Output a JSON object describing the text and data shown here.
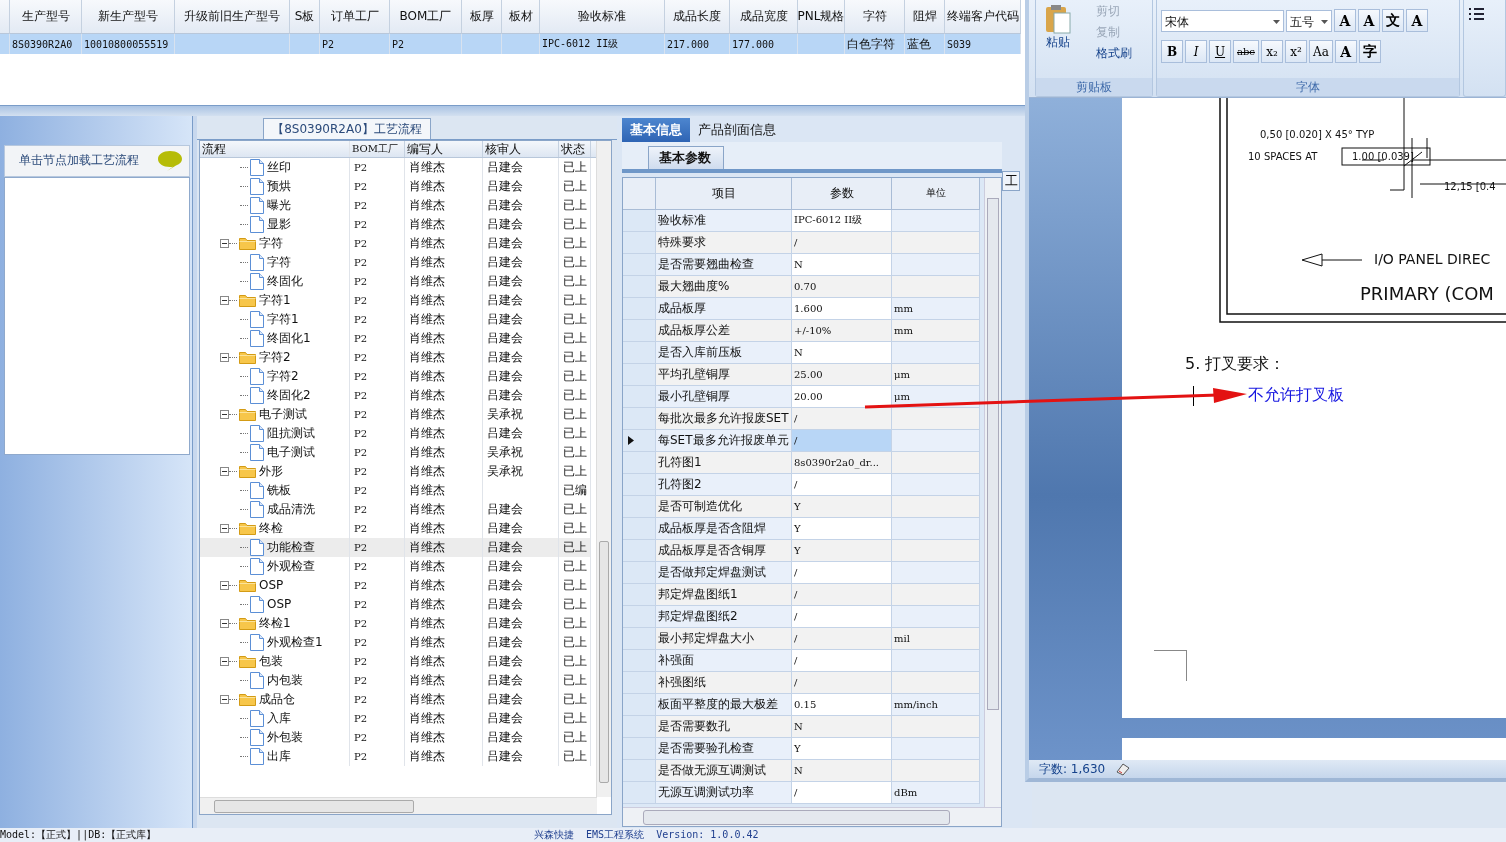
{
  "top_grid": {
    "selected": true,
    "columns": [
      {
        "label": "生产型号",
        "value": "8S0390R2A0"
      },
      {
        "label": "新生产型号",
        "value": "10010800055519"
      },
      {
        "label": "升级前旧生产型号"
      },
      {
        "label": "S板"
      },
      {
        "label": "订单工厂",
        "value": "P2"
      },
      {
        "label": "BOM工厂",
        "value": "P2"
      },
      {
        "label": "板厚"
      },
      {
        "label": "板材"
      },
      {
        "label": "验收标准",
        "value": "IPC-6012 II级"
      },
      {
        "label": "成品长度",
        "value": "217.000"
      },
      {
        "label": "成品宽度",
        "value": "177.000"
      },
      {
        "label": "PNL规格"
      },
      {
        "label": "字符",
        "value": "白色字符"
      },
      {
        "label": "阻焊",
        "value": "蓝色"
      },
      {
        "label": "终端客户代码",
        "value": "S039"
      }
    ]
  },
  "left_panel": {
    "hint": "单击节点加载工艺流程"
  },
  "process": {
    "title": "【8S0390R2A0】工艺流程",
    "columns": [
      "流程",
      "BOM工厂",
      "编写人",
      "核审人",
      "状态"
    ],
    "nodes": [
      {
        "children": [
          {
            "kind": "step",
            "label": "丝印",
            "bom": "P2",
            "writer": "肖维杰",
            "reviewer": "吕建会",
            "status": "已上",
            "selected": false
          },
          {
            "kind": "step",
            "label": "预烘",
            "bom": "P2",
            "writer": "肖维杰",
            "reviewer": "吕建会",
            "status": "已上",
            "selected": false
          },
          {
            "kind": "step",
            "label": "曝光",
            "bom": "P2",
            "writer": "肖维杰",
            "reviewer": "吕建会",
            "status": "已上",
            "selected": false
          },
          {
            "kind": "step",
            "label": "显影",
            "bom": "P2",
            "writer": "肖维杰",
            "reviewer": "吕建会",
            "status": "已上",
            "selected": false
          }
        ]
      },
      {
        "kind": "folder",
        "label": "字符",
        "expanded": true,
        "bom": "P2",
        "writer": "肖维杰",
        "reviewer": "吕建会",
        "status": "已上",
        "selected": false,
        "children": [
          {
            "kind": "step",
            "label": "字符",
            "bom": "P2",
            "writer": "肖维杰",
            "reviewer": "吕建会",
            "status": "已上",
            "selected": false
          },
          {
            "kind": "step",
            "label": "终固化",
            "bom": "P2",
            "writer": "肖维杰",
            "reviewer": "吕建会",
            "status": "已上",
            "selected": false
          }
        ]
      },
      {
        "kind": "folder",
        "label": "字符1",
        "expanded": true,
        "bom": "P2",
        "writer": "肖维杰",
        "reviewer": "吕建会",
        "status": "已上",
        "selected": false,
        "children": [
          {
            "kind": "step",
            "label": "字符1",
            "bom": "P2",
            "writer": "肖维杰",
            "reviewer": "吕建会",
            "status": "已上",
            "selected": false
          },
          {
            "kind": "step",
            "label": "终固化1",
            "bom": "P2",
            "writer": "肖维杰",
            "reviewer": "吕建会",
            "status": "已上",
            "selected": false
          }
        ]
      },
      {
        "kind": "folder",
        "label": "字符2",
        "expanded": true,
        "bom": "P2",
        "writer": "肖维杰",
        "reviewer": "吕建会",
        "status": "已上",
        "selected": false,
        "children": [
          {
            "kind": "step",
            "label": "字符2",
            "bom": "P2",
            "writer": "肖维杰",
            "reviewer": "吕建会",
            "status": "已上",
            "selected": false
          },
          {
            "kind": "step",
            "label": "终固化2",
            "bom": "P2",
            "writer": "肖维杰",
            "reviewer": "吕建会",
            "status": "已上",
            "selected": false
          }
        ]
      },
      {
        "kind": "folder",
        "label": "电子测试",
        "expanded": true,
        "bom": "P2",
        "writer": "肖维杰",
        "reviewer": "吴承祝",
        "status": "已上",
        "selected": false,
        "children": [
          {
            "kind": "step",
            "label": "阻抗测试",
            "bom": "P2",
            "writer": "肖维杰",
            "reviewer": "吕建会",
            "status": "已上",
            "selected": false
          },
          {
            "kind": "step",
            "label": "电子测试",
            "bom": "P2",
            "writer": "肖维杰",
            "reviewer": "吴承祝",
            "status": "已上",
            "selected": false
          }
        ]
      },
      {
        "kind": "folder",
        "label": "外形",
        "expanded": true,
        "bom": "P2",
        "writer": "肖维杰",
        "reviewer": "吴承祝",
        "status": "已上",
        "selected": false,
        "children": [
          {
            "kind": "step",
            "label": "铣板",
            "bom": "P2",
            "writer": "肖维杰",
            "status": "已编",
            "selected": false
          },
          {
            "kind": "step",
            "label": "成品清洗",
            "bom": "P2",
            "writer": "肖维杰",
            "reviewer": "吕建会",
            "status": "已上",
            "selected": false
          }
        ]
      },
      {
        "kind": "folder",
        "label": "终检",
        "expanded": true,
        "bom": "P2",
        "writer": "肖维杰",
        "reviewer": "吕建会",
        "status": "已上",
        "selected": false,
        "children": [
          {
            "kind": "step",
            "label": "功能检查",
            "bom": "P2",
            "writer": "肖维杰",
            "reviewer": "吕建会",
            "status": "已上",
            "selected": true
          },
          {
            "kind": "step",
            "label": "外观检查",
            "bom": "P2",
            "writer": "肖维杰",
            "reviewer": "吕建会",
            "status": "已上",
            "selected": false
          }
        ]
      },
      {
        "kind": "folder",
        "label": "OSP",
        "expanded": true,
        "bom": "P2",
        "writer": "肖维杰",
        "reviewer": "吕建会",
        "status": "已上",
        "selected": false,
        "children": [
          {
            "kind": "step",
            "label": "OSP",
            "bom": "P2",
            "writer": "肖维杰",
            "reviewer": "吕建会",
            "status": "已上",
            "selected": false
          }
        ]
      },
      {
        "kind": "folder",
        "label": "终检1",
        "expanded": true,
        "bom": "P2",
        "writer": "肖维杰",
        "reviewer": "吕建会",
        "status": "已上",
        "selected": false,
        "children": [
          {
            "kind": "step",
            "label": "外观检查1",
            "bom": "P2",
            "writer": "肖维杰",
            "reviewer": "吕建会",
            "status": "已上",
            "selected": false
          }
        ]
      },
      {
        "kind": "folder",
        "label": "包装",
        "expanded": true,
        "bom": "P2",
        "writer": "肖维杰",
        "reviewer": "吕建会",
        "status": "已上",
        "selected": false,
        "children": [
          {
            "kind": "step",
            "label": "内包装",
            "bom": "P2",
            "writer": "肖维杰",
            "reviewer": "吕建会",
            "status": "已上",
            "selected": false
          }
        ]
      },
      {
        "kind": "folder",
        "label": "成品仓",
        "expanded": true,
        "bom": "P2",
        "writer": "肖维杰",
        "reviewer": "吕建会",
        "status": "已上",
        "selected": false,
        "children": [
          {
            "kind": "step",
            "label": "入库",
            "bom": "P2",
            "writer": "肖维杰",
            "reviewer": "吕建会",
            "status": "已上",
            "selected": false
          },
          {
            "kind": "step",
            "label": "外包装",
            "bom": "P2",
            "writer": "肖维杰",
            "reviewer": "吕建会",
            "status": "已上",
            "selected": false
          },
          {
            "kind": "step",
            "label": "出库",
            "bom": "P2",
            "writer": "肖维杰",
            "reviewer": "吕建会",
            "status": "已上",
            "selected": false
          }
        ]
      }
    ]
  },
  "info": {
    "tabs": [
      {
        "label": "基本信息",
        "selected": true
      },
      {
        "label": "产品剖面信息",
        "selected": false
      }
    ],
    "subtab": "基本参数",
    "side_tab": "工",
    "columns": [
      "项目",
      "参数",
      "单位"
    ],
    "rows": [
      {
        "item": "验收标准",
        "value": "IPC-6012 II级",
        "selected": false
      },
      {
        "item": "特殊要求",
        "value": "/",
        "selected": false
      },
      {
        "item": "是否需要翘曲检查",
        "value": "N",
        "selected": false
      },
      {
        "item": "最大翘曲度%",
        "value": "0.70",
        "selected": false
      },
      {
        "item": "成品板厚",
        "value": "1.600",
        "unit": "mm",
        "selected": false
      },
      {
        "item": "成品板厚公差",
        "value": "+/-10%",
        "unit": "mm",
        "selected": false
      },
      {
        "item": "是否入库前压板",
        "value": "N",
        "selected": false
      },
      {
        "item": "平均孔壁铜厚",
        "value": "25.00",
        "unit": "μm",
        "selected": false
      },
      {
        "item": "最小孔壁铜厚",
        "value": "20.00",
        "unit": "μm",
        "selected": false
      },
      {
        "item": "每批次最多允许报废SET",
        "value": "/",
        "selected": false
      },
      {
        "item": "每SET最多允许报废单元",
        "value": "/",
        "selected": true
      },
      {
        "item": "孔符图1",
        "value": "8s0390r2a0_dr...",
        "selected": false
      },
      {
        "item": "孔符图2",
        "value": "/",
        "selected": false
      },
      {
        "item": "是否可制造优化",
        "value": "Y",
        "selected": false
      },
      {
        "item": "成品板厚是否含阻焊",
        "value": "Y",
        "selected": false
      },
      {
        "item": "成品板厚是否含铜厚",
        "value": "Y",
        "selected": false
      },
      {
        "item": "是否做邦定焊盘测试",
        "value": "/",
        "selected": false
      },
      {
        "item": "邦定焊盘图纸1",
        "value": "/",
        "selected": false
      },
      {
        "item": "邦定焊盘图纸2",
        "value": "/",
        "selected": false
      },
      {
        "item": "最小邦定焊盘大小",
        "value": "/",
        "unit": "mil",
        "selected": false
      },
      {
        "item": "补强面",
        "value": "/",
        "selected": false
      },
      {
        "item": "补强图纸",
        "value": "/",
        "selected": false
      },
      {
        "item": "板面平整度的最大极差",
        "value": "0.15",
        "unit": "mm/inch",
        "selected": false
      },
      {
        "item": "是否需要数孔",
        "value": "N",
        "selected": false
      },
      {
        "item": "是否需要验孔检查",
        "value": "Y",
        "selected": false
      },
      {
        "item": "是否做无源互调测试",
        "value": "N",
        "selected": false
      },
      {
        "item": "无源互调测试功率",
        "value": "/",
        "unit": "dBm",
        "selected": false
      }
    ]
  },
  "status_bar": {
    "left": "Model:【正式】||DB:【正式库】",
    "center": "兴森快捷  EMS工程系统  Version: 1.0.0.42"
  },
  "word": {
    "clipboard": {
      "paste": "粘贴",
      "items": [
        {
          "label": "剪切",
          "disabled": true
        },
        {
          "label": "复制",
          "disabled": true
        },
        {
          "label": "格式刷",
          "disabled": false
        }
      ],
      "group": "剪贴板"
    },
    "font": {
      "name": "宋体",
      "size": "五号",
      "top_buttons": [
        "A",
        "A",
        "文",
        "A"
      ],
      "buttons": [
        "B",
        "I",
        "U",
        "abc",
        "x₂",
        "x²",
        "Aa"
      ],
      "extra": [
        "A",
        "字"
      ],
      "group": "字体"
    },
    "drawing": [
      "0,50 [0.020] X 45° TYP",
      "10 SPACES AT",
      "1.00 [0.039]",
      "12,15 [0.4",
      "I/O PANEL DIREC",
      "PRIMARY (COM"
    ],
    "heading": "5. 打叉要求：",
    "answer": "不允许打叉板",
    "word_count": "字数: 1,630"
  }
}
